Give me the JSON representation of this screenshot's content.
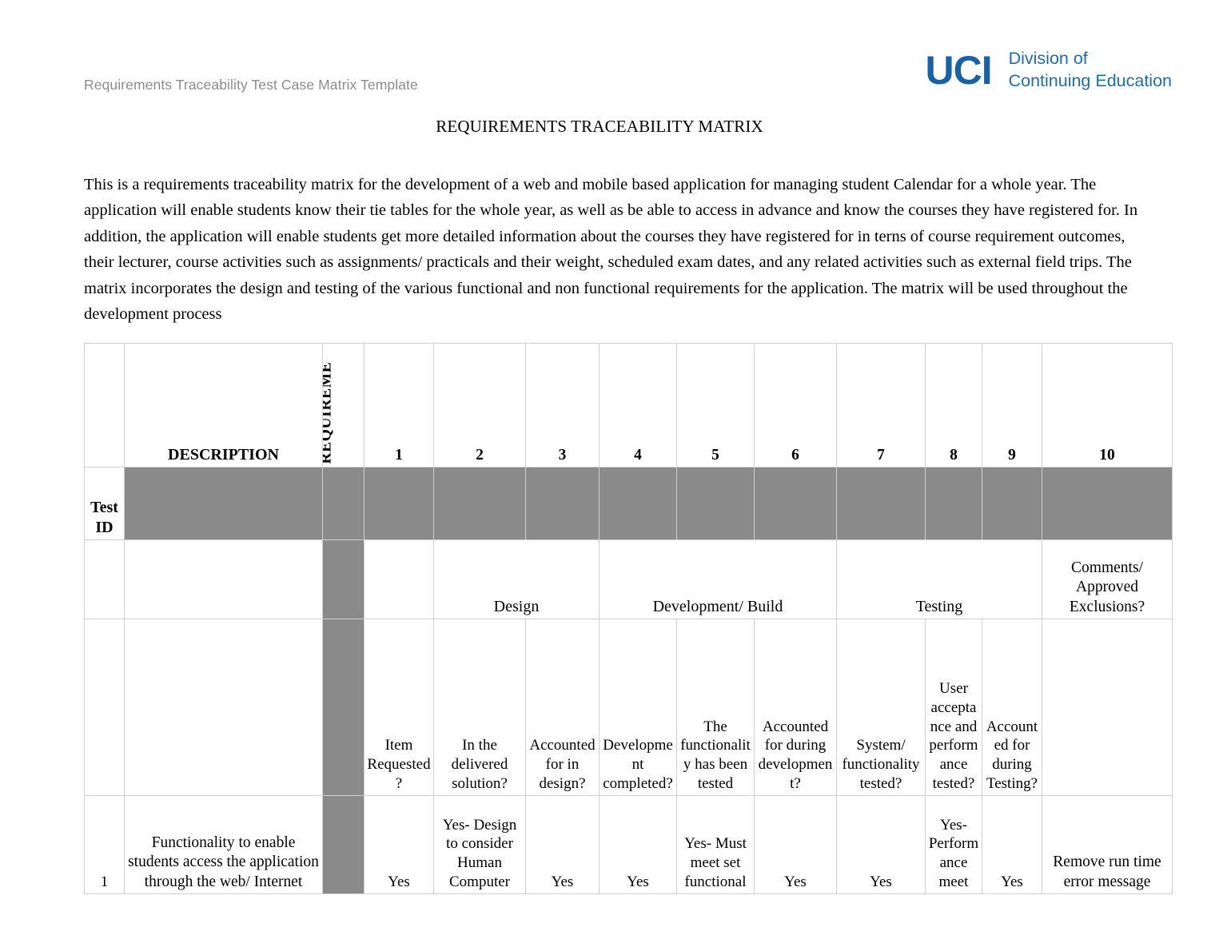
{
  "header": {
    "doc_label": "Requirements Traceability Test Case Matrix Template",
    "logo": {
      "mark": "UCI",
      "line1": "Division of",
      "line2": "Continuing Education",
      "mark_color": "#1662a8",
      "text_color": "#1a6fb3"
    }
  },
  "title": "REQUIREMENTS TRACEABILITY MATRIX",
  "intro": "This is a requirements traceability matrix for the development of a web and mobile based application for managing student Calendar for a whole year. The application will enable students know their tie tables for the whole year, as well as be able to access in advance and know the courses they have registered for. In addition, the application will enable students get more detailed information about the courses they have registered for in terns of course requirement outcomes, their lecturer, course activities such as assignments/ practicals and their weight, scheduled exam dates, and any related activities such as external field trips. The matrix incorporates the design and testing of the various functional and non functional requirements for the application. The matrix will be used throughout the development process",
  "table": {
    "colors": {
      "gray_fill": "#8a8a8a",
      "border": "#cfcfcf"
    },
    "header_row": {
      "testid_blank": "",
      "description": "DESCRIPTION",
      "requirement_vertical": "REQUIREME",
      "numbers": [
        "1",
        "2",
        "3",
        "4",
        "5",
        "6",
        "7",
        "8",
        "9",
        "10"
      ]
    },
    "testid_label": "Test ID",
    "phase_row": {
      "design": "Design",
      "development_build": "Development/ Build",
      "testing": "Testing",
      "comments": "Comments/ Approved Exclusions?"
    },
    "question_row": {
      "q1": "Item Requested?",
      "q2": "In the delivered solution?",
      "q3": "Accounted for in design?",
      "q4": "Development completed?",
      "q5": "The functionality has been tested",
      "q6": "Accounted for during development?",
      "q7": "System/ functionality tested?",
      "q8": "User acceptance and performance tested?",
      "q9": "Accounted for during Testing?",
      "q10": ""
    },
    "rows": [
      {
        "test_id": "1",
        "description": "Functionality to enable students access the application through the web/ Internet",
        "requirement": "",
        "c1": "Yes",
        "c2": "Yes- Design to consider Human Computer",
        "c3": "Yes",
        "c4": "Yes",
        "c5": "Yes- Must meet set functional",
        "c6": "Yes",
        "c7": "Yes",
        "c8": "Yes- Performance meet",
        "c9": "Yes",
        "c10": "Remove run time error message"
      }
    ]
  }
}
